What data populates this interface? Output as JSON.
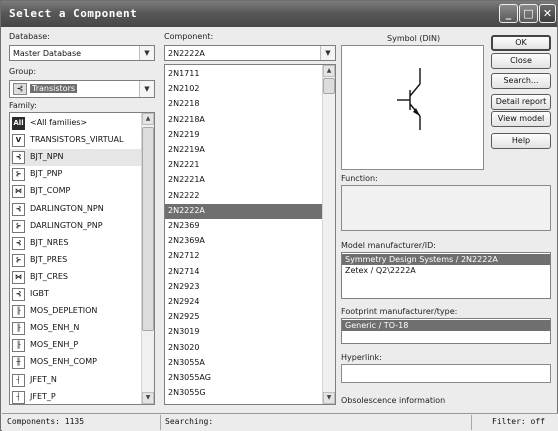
{
  "window": {
    "title": "Select a Component",
    "minimize": "_",
    "maximize": "□",
    "close": "✕"
  },
  "database": {
    "label": "Database:",
    "value": "Master Database"
  },
  "group": {
    "label": "Group:",
    "value": "Transistors",
    "icon": "transistor-icon"
  },
  "family": {
    "label": "Family:",
    "items": [
      {
        "label": "<All families>",
        "icon": "all-icon",
        "glyph": "All"
      },
      {
        "label": "TRANSISTORS_VIRTUAL",
        "icon": "virtual-icon",
        "glyph": "V"
      },
      {
        "label": "BJT_NPN",
        "icon": "bjt-npn-icon",
        "glyph": "⊰"
      },
      {
        "label": "BJT_PNP",
        "icon": "bjt-pnp-icon",
        "glyph": "⊱"
      },
      {
        "label": "BJT_COMP",
        "icon": "bjt-comp-icon",
        "glyph": "⋈"
      },
      {
        "label": "DARLINGTON_NPN",
        "icon": "darlington-npn-icon",
        "glyph": "⊰"
      },
      {
        "label": "DARLINGTON_PNP",
        "icon": "darlington-pnp-icon",
        "glyph": "⊱"
      },
      {
        "label": "BJT_NRES",
        "icon": "bjt-nres-icon",
        "glyph": "⊰"
      },
      {
        "label": "BJT_PRES",
        "icon": "bjt-pres-icon",
        "glyph": "⊱"
      },
      {
        "label": "BJT_CRES",
        "icon": "bjt-cres-icon",
        "glyph": "⋈"
      },
      {
        "label": "IGBT",
        "icon": "igbt-icon",
        "glyph": "⊰"
      },
      {
        "label": "MOS_DEPLETION",
        "icon": "mos-depletion-icon",
        "glyph": "╟"
      },
      {
        "label": "MOS_ENH_N",
        "icon": "mos-enh-n-icon",
        "glyph": "╟"
      },
      {
        "label": "MOS_ENH_P",
        "icon": "mos-enh-p-icon",
        "glyph": "╟"
      },
      {
        "label": "MOS_ENH_COMP",
        "icon": "mos-enh-comp-icon",
        "glyph": "╫"
      },
      {
        "label": "JFET_N",
        "icon": "jfet-n-icon",
        "glyph": "┤"
      },
      {
        "label": "JFET_P",
        "icon": "jfet-p-icon",
        "glyph": "┤"
      }
    ],
    "selected_index": 2
  },
  "component": {
    "label": "Component:",
    "value": "2N2222A",
    "items": [
      "2N1711",
      "2N2102",
      "2N2218",
      "2N2218A",
      "2N2219",
      "2N2219A",
      "2N2221",
      "2N2221A",
      "2N2222",
      "2N2222A",
      "2N2369",
      "2N2369A",
      "2N2712",
      "2N2714",
      "2N2923",
      "2N2924",
      "2N2925",
      "2N3019",
      "2N3020",
      "2N3055A",
      "2N3055AG",
      "2N3055G",
      "2N3090"
    ],
    "selected_index": 9
  },
  "symbol": {
    "label": "Symbol (DIN)"
  },
  "buttons": {
    "ok": "OK",
    "close": "Close",
    "search": "Search...",
    "detail_report": "Detail report",
    "view_model": "View model",
    "help": "Help"
  },
  "function": {
    "label": "Function:"
  },
  "model_manufacturer": {
    "label": "Model manufacturer/ID:",
    "items": [
      "Symmetry Design Systems / 2N2222A",
      "Zetex / Q2\\2222A"
    ],
    "selected_index": 0
  },
  "footprint": {
    "label": "Footprint manufacturer/type:",
    "items": [
      "Generic / TO-18"
    ],
    "selected_index": 0
  },
  "hyperlink": {
    "label": "Hyperlink:"
  },
  "obsolescence": {
    "label": "Obsolescence information"
  },
  "status": {
    "components": "Components: 1135",
    "searching": "Searching:",
    "filter": "Filter: off"
  }
}
